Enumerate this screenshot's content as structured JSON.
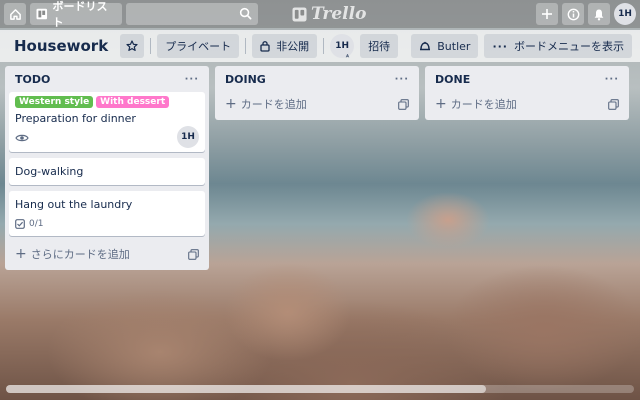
{
  "header": {
    "boards_label": "ボードリスト",
    "logo_text": "Trello",
    "avatar": "1H"
  },
  "board": {
    "title": "Housework",
    "visibility": "プライベート",
    "access": "非公開",
    "member": "1H",
    "invite_label": "招待",
    "butler_label": "Butler",
    "menu_label": "ボードメニューを表示"
  },
  "lists": [
    {
      "title": "TODO",
      "add_label": "さらにカードを追加",
      "cards": [
        {
          "labels": [
            {
              "text": "Western style",
              "color": "#61bd4f"
            },
            {
              "text": "With dessert",
              "color": "#ff78cb"
            }
          ],
          "title": "Preparation for dinner",
          "member": "1H"
        },
        {
          "title": "Dog-walking"
        },
        {
          "title": "Hang out the laundry",
          "checklist": "0/1"
        }
      ]
    },
    {
      "title": "DOING",
      "add_label": "カードを追加",
      "cards": []
    },
    {
      "title": "DONE",
      "add_label": "カードを追加",
      "cards": []
    }
  ],
  "colors": {
    "header_bg": "#8a8c8c",
    "list_bg": "#ebecf0",
    "label_green": "#61bd4f",
    "label_pink": "#ff78cb"
  }
}
